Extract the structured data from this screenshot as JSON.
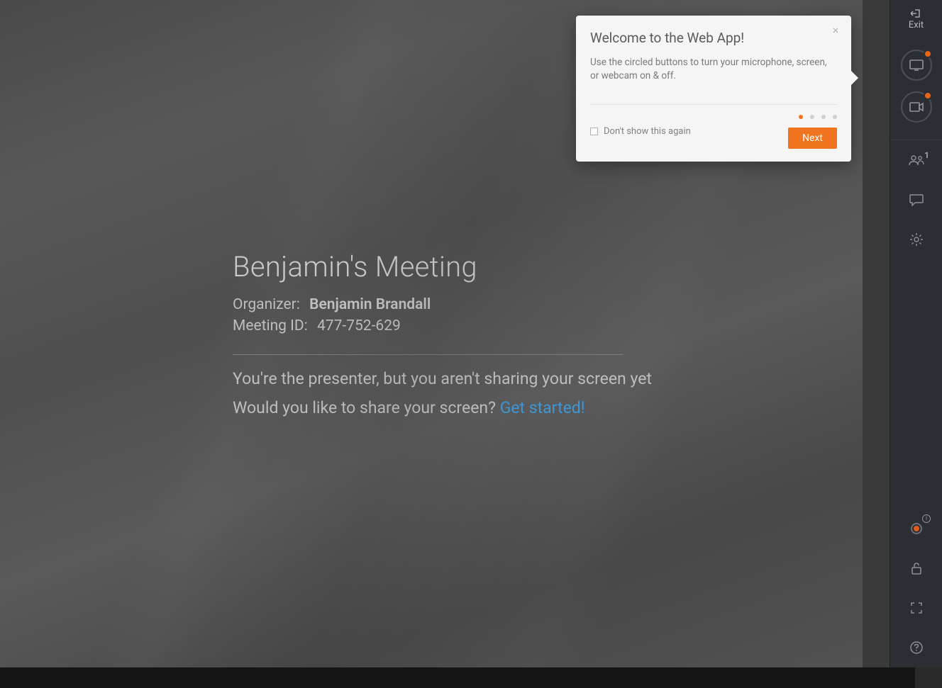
{
  "meeting": {
    "title": "Benjamin's Meeting",
    "organizer_label": "Organizer:",
    "organizer_name": "Benjamin Brandall",
    "meeting_id_label": "Meeting ID:",
    "meeting_id": "477-752-629",
    "presenter_msg": "You're the presenter, but you aren't sharing your screen yet",
    "share_prompt_q": "Would you like to share your screen? ",
    "share_prompt_link": "Get started!"
  },
  "sidebar": {
    "exit_label": "Exit",
    "attendee_count": "1"
  },
  "popover": {
    "title": "Welcome to the Web App!",
    "body": "Use the circled buttons to turn your microphone, screen, or webcam on & off.",
    "dont_show_label": "Don't show this again",
    "next_label": "Next"
  },
  "colors": {
    "accent": "#f0741e",
    "link": "#3d95d4"
  }
}
